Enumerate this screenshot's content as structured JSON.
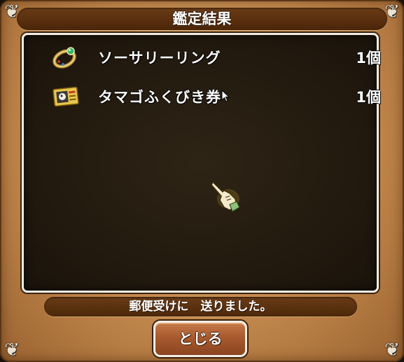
{
  "dialog": {
    "title": "鑑定結果",
    "items": [
      {
        "name": "ソーサリーリング",
        "count": "1個",
        "icon": "ring-icon"
      },
      {
        "name": "タマゴふくびき券",
        "count": "1個",
        "icon": "lottery-ticket-icon"
      }
    ],
    "message": "郵便受けに　送りました。",
    "close_label": "とじる"
  },
  "colors": {
    "frame": "#c48a4e",
    "panel": "#231a0f",
    "title_bar": "#5a300e",
    "button": "#a85a2e",
    "text": "#ffffff"
  }
}
